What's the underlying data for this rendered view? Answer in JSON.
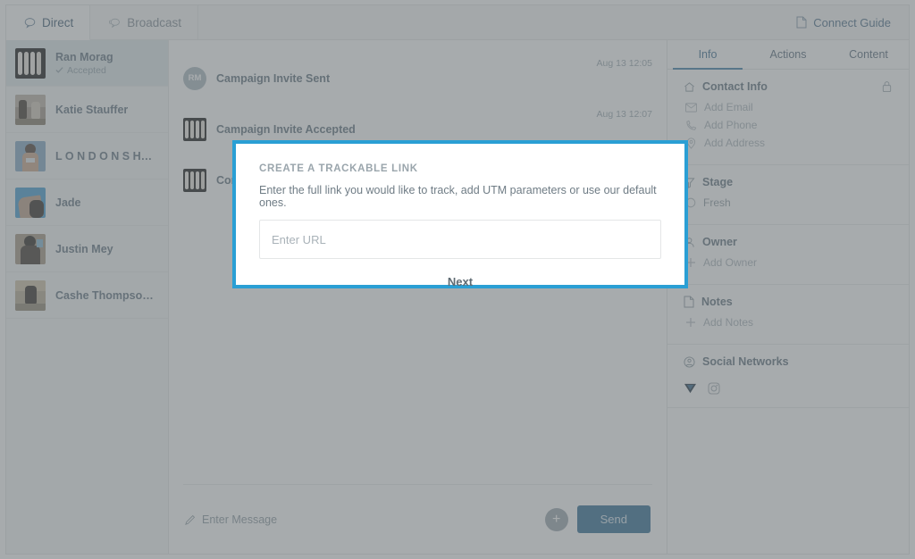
{
  "topbar": {
    "tabs": [
      {
        "label": "Direct",
        "icon": "chat-bubble-icon",
        "active": true
      },
      {
        "label": "Broadcast",
        "icon": "broadcast-bubble-icon",
        "active": false
      }
    ],
    "connect_guide": {
      "label": "Connect Guide",
      "icon": "document-icon"
    }
  },
  "contacts": [
    {
      "name": "Ran Morag",
      "status": "Accepted",
      "active": true
    },
    {
      "name": "Katie Stauffer",
      "status": "",
      "active": false
    },
    {
      "name": "L O N D O N S H…",
      "status": "",
      "active": false
    },
    {
      "name": "Jade",
      "status": "",
      "active": false
    },
    {
      "name": "Justin Mey",
      "status": "",
      "active": false
    },
    {
      "name": "Cashe Thompso…",
      "status": "",
      "active": false
    }
  ],
  "timeline": [
    {
      "title": "Campaign Invite Sent",
      "time": "Aug 13 12:05",
      "avatar_initials": "RM",
      "avatar_type": "initials"
    },
    {
      "title": "Campaign Invite Accepted",
      "time": "Aug 13 12:07",
      "avatar_initials": "",
      "avatar_type": "photo"
    },
    {
      "title": "Connected",
      "time": "",
      "avatar_initials": "",
      "avatar_type": "photo"
    }
  ],
  "composer": {
    "placeholder": "Enter Message",
    "pencil_icon": "pencil-icon",
    "attach_label": "+",
    "send_label": "Send"
  },
  "right_panel": {
    "tabs": [
      {
        "label": "Info",
        "active": true
      },
      {
        "label": "Actions",
        "active": false
      },
      {
        "label": "Content",
        "active": false
      }
    ],
    "sections": [
      {
        "title": "Contact Info",
        "icon": "home-icon",
        "locked": true,
        "rows": [
          {
            "label": "Add Email",
            "icon": "mail-icon"
          },
          {
            "label": "Add Phone",
            "icon": "phone-icon"
          },
          {
            "label": "Add Address",
            "icon": "pin-icon"
          }
        ]
      },
      {
        "title": "Stage",
        "icon": "funnel-icon",
        "locked": false,
        "rows": [
          {
            "label": "Fresh",
            "icon": "circle-icon"
          }
        ]
      },
      {
        "title": "Owner",
        "icon": "user-icon",
        "locked": false,
        "rows": [
          {
            "label": "Add Owner",
            "icon": "plus-icon"
          }
        ]
      },
      {
        "title": "Notes",
        "icon": "note-icon",
        "locked": false,
        "rows": [
          {
            "label": "Add Notes",
            "icon": "plus-icon"
          }
        ]
      }
    ],
    "social": {
      "title": "Social Networks",
      "icon": "avatar-circle-icon",
      "networks": [
        "linkedin-icon",
        "instagram-icon"
      ]
    }
  },
  "modal": {
    "title": "CREATE A TRACKABLE LINK",
    "description": "Enter the full link you would like to track, add UTM parameters or use our default ones.",
    "input_placeholder": "Enter URL",
    "input_value": "",
    "next_label": "Next"
  },
  "colors": {
    "accent_blue": "#2a9fd4",
    "send_blue": "#2c6a92",
    "tab_active": "#3a7ba5",
    "text_muted": "#8b98a1",
    "overlay": "rgba(109,115,119,0.60)"
  }
}
